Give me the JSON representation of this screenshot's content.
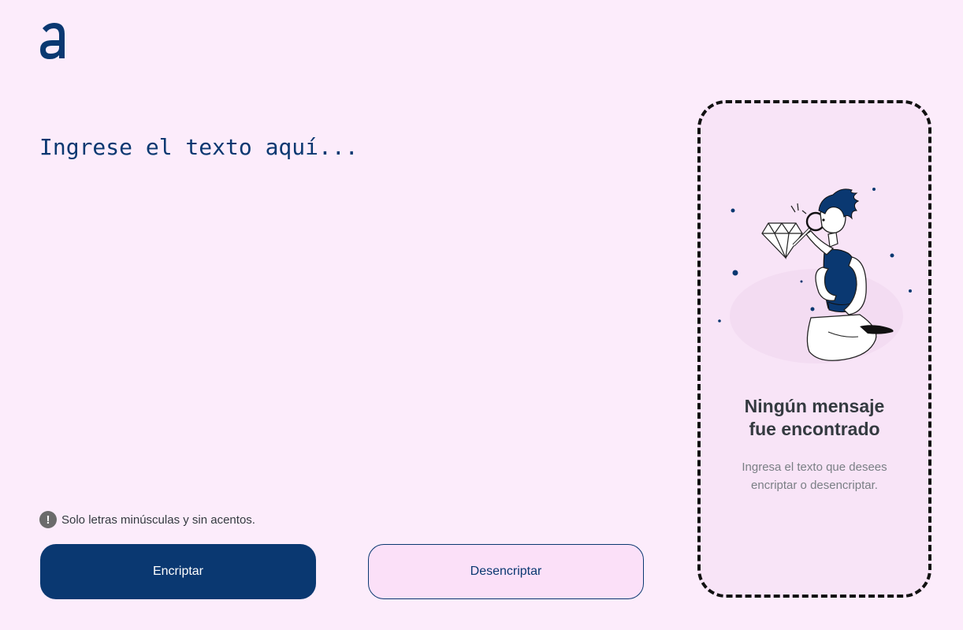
{
  "brand": {
    "logo_icon": "alura-a-logo-icon",
    "color": "#0a3871"
  },
  "input": {
    "placeholder": "Ingrese el texto aquí...",
    "value": ""
  },
  "hint": {
    "icon": "exclamation-circle-icon",
    "text": "Solo letras minúsculas y sin acentos."
  },
  "buttons": {
    "encrypt_label": "Encriptar",
    "decrypt_label": "Desencriptar"
  },
  "output": {
    "illustration": "person-with-magnifying-glass-and-diamond",
    "title": "Ningún mensaje fue encontrado",
    "subtitle": "Ingresa el texto que desees encriptar o desencriptar."
  },
  "colors": {
    "background": "#fcecfb",
    "primary": "#0a3871",
    "panel_background": "#f8e4f7"
  }
}
